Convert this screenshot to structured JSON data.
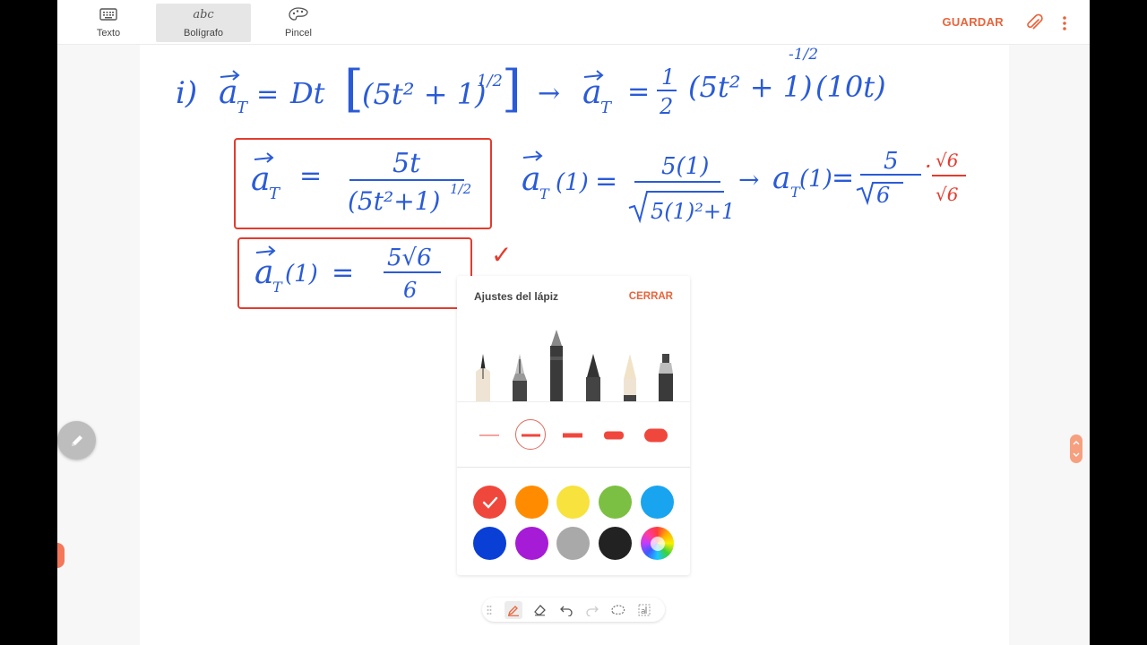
{
  "toolbar": {
    "modes": [
      {
        "label": "Texto",
        "icon": "keyboard-icon"
      },
      {
        "label": "Bolígrafo",
        "icon": "pen-handwriting-icon",
        "glyph": "abc"
      },
      {
        "label": "Pincel",
        "icon": "palette-icon"
      }
    ],
    "save_label": "GUARDAR",
    "attach_icon": "paperclip-icon",
    "more_icon": "more-vertical-icon"
  },
  "note": {
    "line1": {
      "part": "i)",
      "lhs_var": "a",
      "lhs_sub": "T",
      "equals": "=",
      "op": "Dt",
      "inner": "(5t² + 1)",
      "exp": "1/2",
      "arrow": "→",
      "rhs_var": "a",
      "rhs_sub": "T",
      "rhs_eq": "=",
      "frac_num": "1",
      "frac_den": "2",
      "rhs_inner": "(5t² + 1)",
      "rhs_exp": "-1/2",
      "rhs_factor": "(10t)"
    },
    "box1": {
      "var": "a",
      "sub": "T",
      "equals": "=",
      "num": "5t",
      "den": "(5t²+1)",
      "den_exp": "1/2"
    },
    "eval": {
      "var": "a",
      "sub": "T",
      "arg": "(1)",
      "equals": "=",
      "num": "5(1)",
      "den": "5(1)²+1",
      "arrow": "→",
      "var2": "a",
      "sub2": "T",
      "arg2": "(1)",
      "equals2": "=",
      "num2": "5",
      "den2": "6",
      "mult": "·",
      "rat_num": "√6",
      "rat_den": "√6"
    },
    "box2": {
      "var": "a",
      "sub": "T",
      "arg": "(1)",
      "equals": "=",
      "num": "5√6",
      "den": "6"
    },
    "check": "✓"
  },
  "pen_panel": {
    "title": "Ajustes del lápiz",
    "close_label": "CERRAR",
    "pens": [
      "fountain-pen-icon",
      "calligraphy-pen-icon",
      "pencil-icon",
      "chisel-pen-icon",
      "brush-pen-icon",
      "marker-icon"
    ],
    "selected_pen": 2,
    "sizes": 5,
    "selected_size": 1,
    "colors": [
      "#f0473c",
      "#ff8c00",
      "#f7e23e",
      "#7cc043",
      "#19a4ef",
      "#0a3fd6",
      "#a61bd6",
      "#a9a9a9",
      "#222222",
      "color-wheel"
    ],
    "selected_color": 0
  },
  "bottom_tools": [
    "drag-handle-icon",
    "pen-icon",
    "eraser-icon",
    "undo-icon",
    "redo-icon",
    "lasso-icon",
    "text-convert-icon"
  ],
  "active_tool": 1,
  "accent": "#e8643c",
  "ink_blue": "#2a5bd7",
  "ink_red": "#e23c2e"
}
